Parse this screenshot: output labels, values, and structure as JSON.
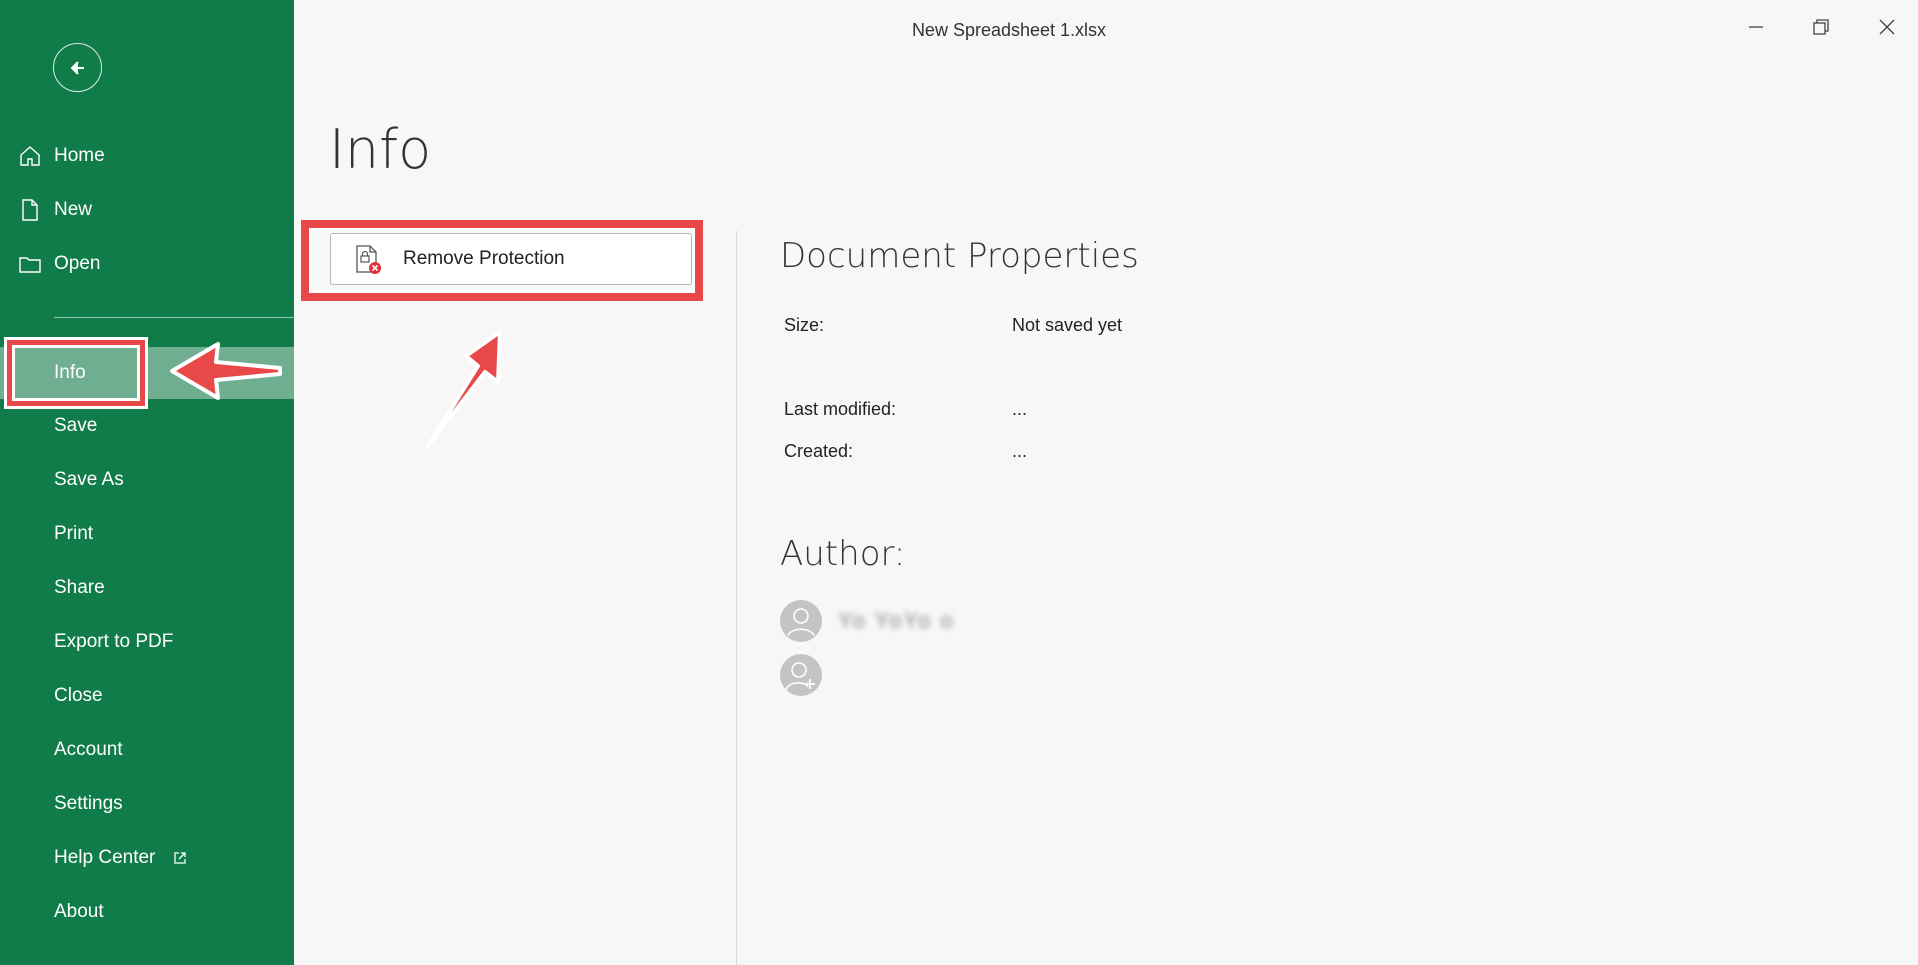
{
  "window": {
    "title": "New Spreadsheet 1.xlsx",
    "controls": [
      "minimize-icon",
      "restore-icon",
      "close-icon"
    ]
  },
  "sidebar": {
    "background": "#107c4a",
    "active_background": "#6fae90",
    "back_icon": "back-arrow-icon",
    "top_items": [
      {
        "label": "Home",
        "icon": "home-icon"
      },
      {
        "label": "New",
        "icon": "new-file-icon"
      },
      {
        "label": "Open",
        "icon": "folder-icon"
      }
    ],
    "items": [
      {
        "label": "Info",
        "active": true
      },
      {
        "label": "Save"
      },
      {
        "label": "Save As"
      },
      {
        "label": "Print"
      },
      {
        "label": "Share"
      },
      {
        "label": "Export to PDF"
      },
      {
        "label": "Close"
      },
      {
        "label": "Account"
      },
      {
        "label": "Settings"
      },
      {
        "label": "Help Center",
        "icon": "external-link-icon"
      },
      {
        "label": "About"
      }
    ]
  },
  "main": {
    "page_title": "Info",
    "remove_protection": {
      "label": "Remove Protection",
      "icon": "unprotect-document-icon"
    },
    "document_properties": {
      "title": "Document Properties",
      "size_label": "Size:",
      "size_value": "Not saved yet",
      "last_modified_label": "Last modified:",
      "last_modified_value": "...",
      "created_label": "Created:",
      "created_value": "..."
    },
    "author": {
      "title": "Author:",
      "name": "Yo  YoYo o",
      "avatar_icon": "user-icon",
      "add_icon": "add-user-icon"
    }
  },
  "annotations": {
    "highlight_color": "#e94848"
  }
}
